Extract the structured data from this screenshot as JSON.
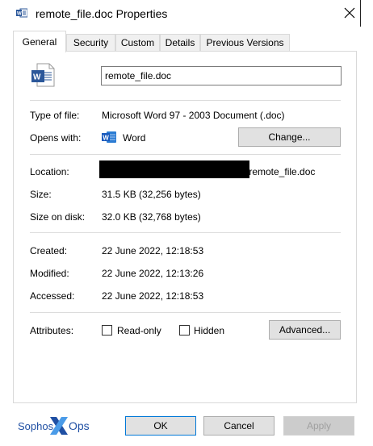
{
  "window": {
    "title": "remote_file.doc Properties"
  },
  "tabs": [
    {
      "label": "General"
    },
    {
      "label": "Security"
    },
    {
      "label": "Custom"
    },
    {
      "label": "Details"
    },
    {
      "label": "Previous Versions"
    }
  ],
  "file": {
    "name": "remote_file.doc"
  },
  "type": {
    "label": "Type of file:",
    "value": "Microsoft Word 97 - 2003 Document (.doc)"
  },
  "opens": {
    "label": "Opens with:",
    "value": "Word",
    "change_button": "Change..."
  },
  "location": {
    "label": "Location:",
    "value": "\\remote_file.doc"
  },
  "size": {
    "label": "Size:",
    "value": "31.5 KB (32,256 bytes)"
  },
  "size_on_disk": {
    "label": "Size on disk:",
    "value": "32.0 KB (32,768 bytes)"
  },
  "created": {
    "label": "Created:",
    "value": "22 June 2022, 12:18:53"
  },
  "modified": {
    "label": "Modified:",
    "value": "22 June 2022, 12:13:26"
  },
  "accessed": {
    "label": "Accessed:",
    "value": "22 June 2022, 12:18:53"
  },
  "attributes": {
    "label": "Attributes:",
    "readonly_label": "Read-only",
    "readonly_checked": false,
    "hidden_label": "Hidden",
    "hidden_checked": false,
    "advanced_button": "Advanced..."
  },
  "footer": {
    "ok": "OK",
    "cancel": "Cancel",
    "apply": "Apply"
  },
  "brand": {
    "part1": "Sophos",
    "part2": "Ops"
  },
  "colors": {
    "word_blue": "#2b579a",
    "brand_blue": "#1f4fa3",
    "accent": "#0078d7"
  }
}
